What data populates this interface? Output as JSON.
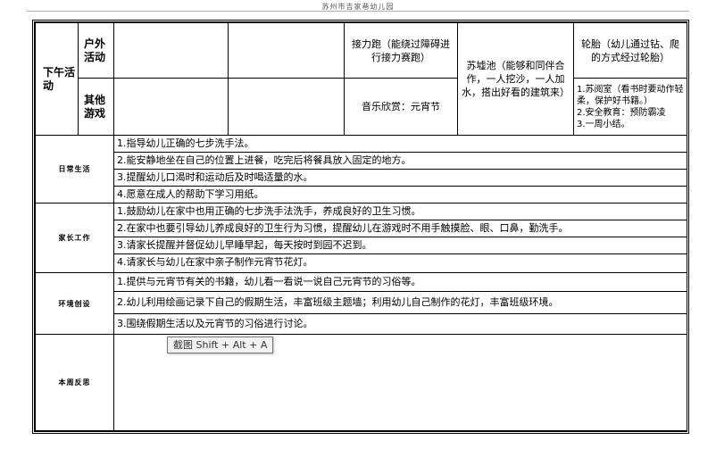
{
  "page_header": "苏州市吉家巷幼儿园",
  "afternoon": {
    "section_label": "下午活动",
    "outdoor_label": "户外活动",
    "other_label": "其他游戏",
    "relay_run": "接力跑（能绕过障碍进行接力赛跑）",
    "music": "音乐欣赏：元宵节",
    "sandpit": "苏墟池（能够和同伴合作，一人挖沙，一人加水，搭出好看的建筑来）",
    "tires": "轮胎（幼儿通过钻、爬的方式经过轮胎）",
    "other_games": [
      "1.苏阅室（看书时要动作轻柔，保护好书籍。）",
      "2.安全教育：预防霸凌",
      "3.一周小结。"
    ]
  },
  "daily_life": {
    "label": "日常生活",
    "items": [
      "1.指导幼儿正确的七步洗手法。",
      "2.能安静地坐在自己的位置上进餐，吃完后将餐具放入固定的地方。",
      "3.提醒幼儿口渴时和运动后及时喝适量的水。",
      "4.愿意在成人的帮助下学习用纸。"
    ]
  },
  "parent_work": {
    "label": "家长工作",
    "items": [
      "1.鼓励幼儿在家中也用正确的七步洗手法洗手，养成良好的卫生习惯。",
      "2.在家中也要引导幼儿养成良好的卫生行为习惯，提醒幼儿在游戏时不用手触摸脸、眼、口鼻，勤洗手。",
      "3.请家长提醒并督促幼儿早睡早起，每天按时到园不迟到。",
      "4.请家长与幼儿在家中亲子制作元宵节花灯。"
    ]
  },
  "environment": {
    "label": "环境创设",
    "items": [
      "1.提供与元宵节有关的书籍，幼儿看一看说一说自己元宵节的习俗等。",
      "2.幼儿利用绘画记录下自己的假期生活，丰富班级主题墙；利用幼儿自己制作的花灯，丰富班级环境。",
      "3.围绕假期生活以及元宵节的习俗进行讨论。"
    ]
  },
  "reflection": {
    "label": "本周反思",
    "content": ""
  },
  "tooltip": "截图 Shift + Alt + A"
}
